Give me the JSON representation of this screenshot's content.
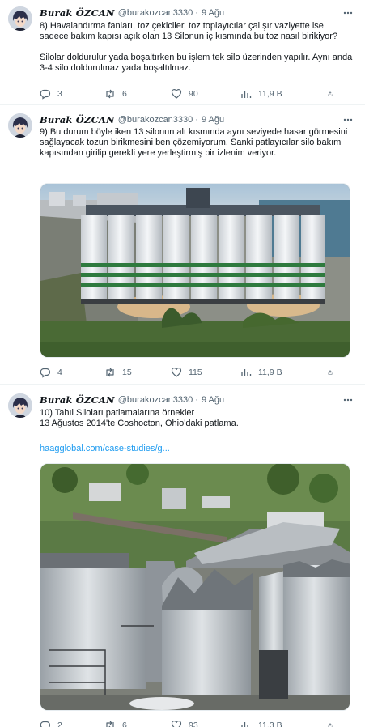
{
  "tweets": [
    {
      "author": "Burak ÖZCAN",
      "handle": "@burakozcan3330",
      "separator": "·",
      "date": "9 Ağu",
      "text": "8) Havalandırma fanları, toz çekiciler, toz toplayıcılar çalışır vaziyette ise sadece bakım kapısı açık olan  13 Silonun iç kısmında bu toz nasıl birikiyor?\n\nSilolar doldurulur yada boşaltırken bu işlem tek silo üzerinden yapılır. Aynı anda 3-4 silo doldurulmaz yada boşaltılmaz.",
      "stats": {
        "replies": "3",
        "retweets": "6",
        "likes": "90",
        "views": "11,9 B"
      }
    },
    {
      "author": "Burak ÖZCAN",
      "handle": "@burakozcan3330",
      "separator": "·",
      "date": "9 Ağu",
      "text": "9) Bu durum böyle iken 13 silonun  alt kısmında aynı seviyede hasar görmesini sağlayacak  tozun birikmesini ben çözemiyorum. Sanki patlayıcılar silo bakım kapısından girilip gerekli yere yerleştirmiş bir izlenim veriyor.",
      "stats": {
        "replies": "4",
        "retweets": "15",
        "likes": "115",
        "views": "11,9 B"
      }
    },
    {
      "author": "Burak ÖZCAN",
      "handle": "@burakozcan3330",
      "separator": "·",
      "date": "9 Ağu",
      "text": "10) Tahıl Siloları patlamalarına örnekler\n 13 Ağustos 2014'te Coshocton, Ohio'daki patlama.",
      "link": "haagglobal.com/case-studies/g...",
      "stats": {
        "replies": "2",
        "retweets": "6",
        "likes": "93",
        "views": "11,3 B"
      }
    }
  ],
  "colors": {
    "link": "#1d9bf0",
    "muted": "#536471",
    "text": "#0f1419",
    "divider": "#eff3f4"
  },
  "icons": [
    "more-icon",
    "reply-icon",
    "retweet-icon",
    "like-icon",
    "views-icon",
    "share-icon"
  ]
}
